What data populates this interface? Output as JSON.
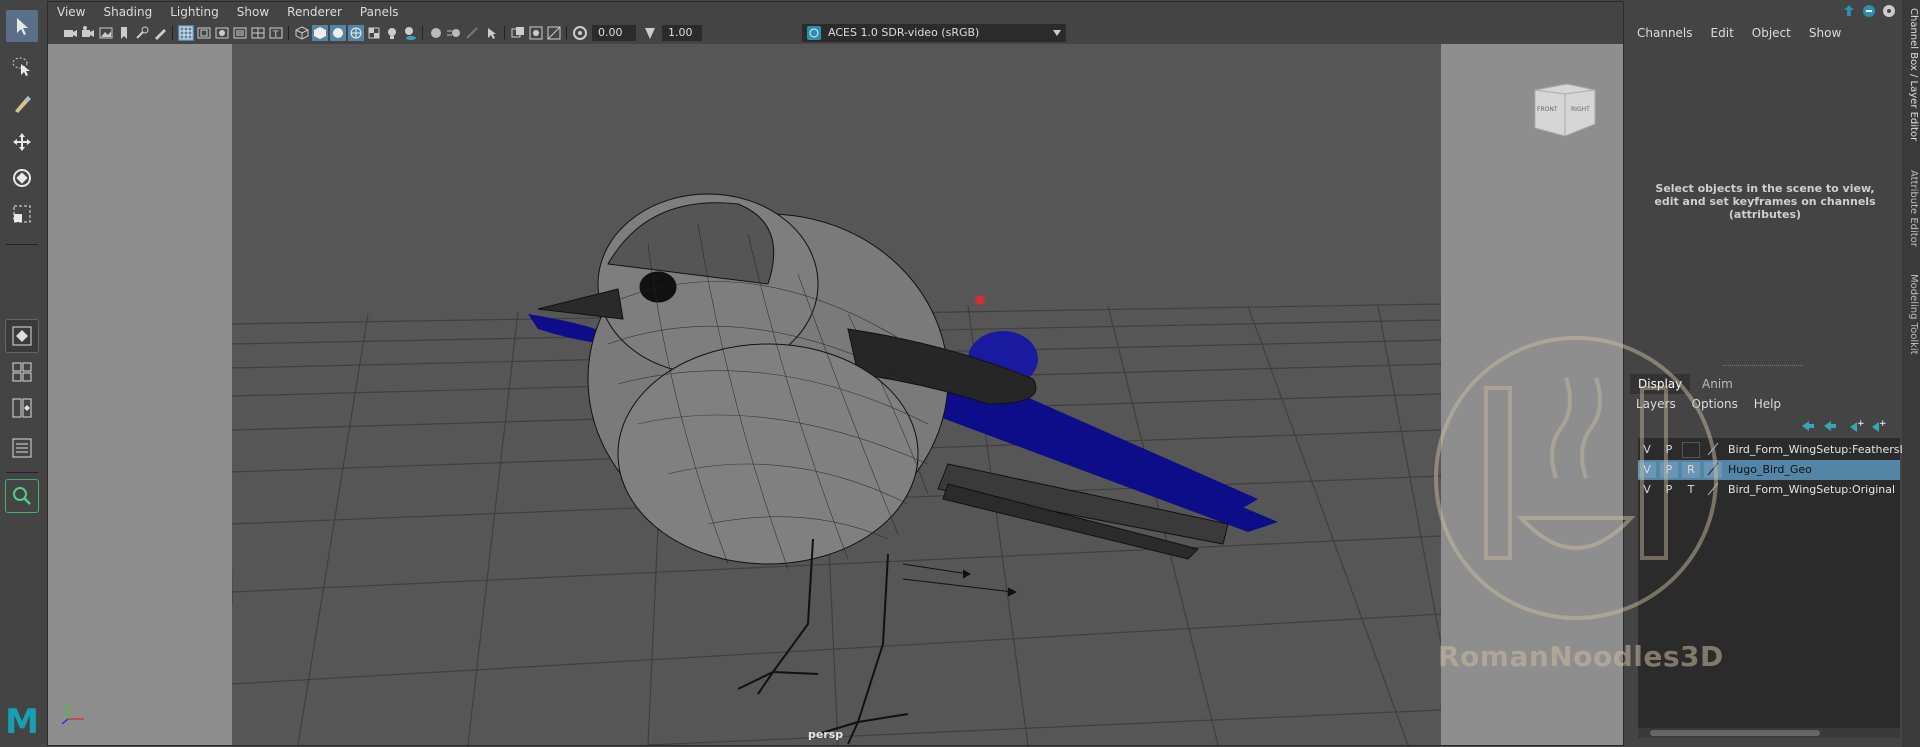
{
  "viewport": {
    "menu": [
      "View",
      "Shading",
      "Lighting",
      "Show",
      "Renderer",
      "Panels"
    ],
    "exposure_value": "0.00",
    "gamma_value": "1.00",
    "color_management": "ACES 1.0 SDR-video (sRGB)",
    "camera_label": "persp",
    "viewcube_front": "FRONT",
    "viewcube_right": "RIGHT"
  },
  "channel_box": {
    "menu": [
      "Channels",
      "Edit",
      "Object",
      "Show"
    ],
    "empty_message": "Select objects in the scene to view, edit and set keyframes on channels (attributes)"
  },
  "layer_editor": {
    "tabs": [
      "Display",
      "Anim"
    ],
    "active_tab": "Display",
    "menu": [
      "Layers",
      "Options",
      "Help"
    ],
    "layers": [
      {
        "v": "V",
        "p": "P",
        "t": "",
        "name": "Bird_Form_WingSetup:FeathersLa",
        "selected": false
      },
      {
        "v": "V",
        "p": "P",
        "t": "R",
        "name": "Hugo_Bird_Geo",
        "selected": true
      },
      {
        "v": "V",
        "p": "P",
        "t": "T",
        "name": "Bird_Form_WingSetup:Original",
        "selected": false
      }
    ]
  },
  "side_tabs": [
    "Channel Box / Layer Editor",
    "Attribute Editor",
    "Modeling Toolkit"
  ],
  "watermark": "RomanNoodles3D",
  "logo_letter": "M",
  "colors": {
    "accent": "#5285a6",
    "maya_logo": "#17a0b4",
    "feathers_blue": "#0d0d8a"
  }
}
